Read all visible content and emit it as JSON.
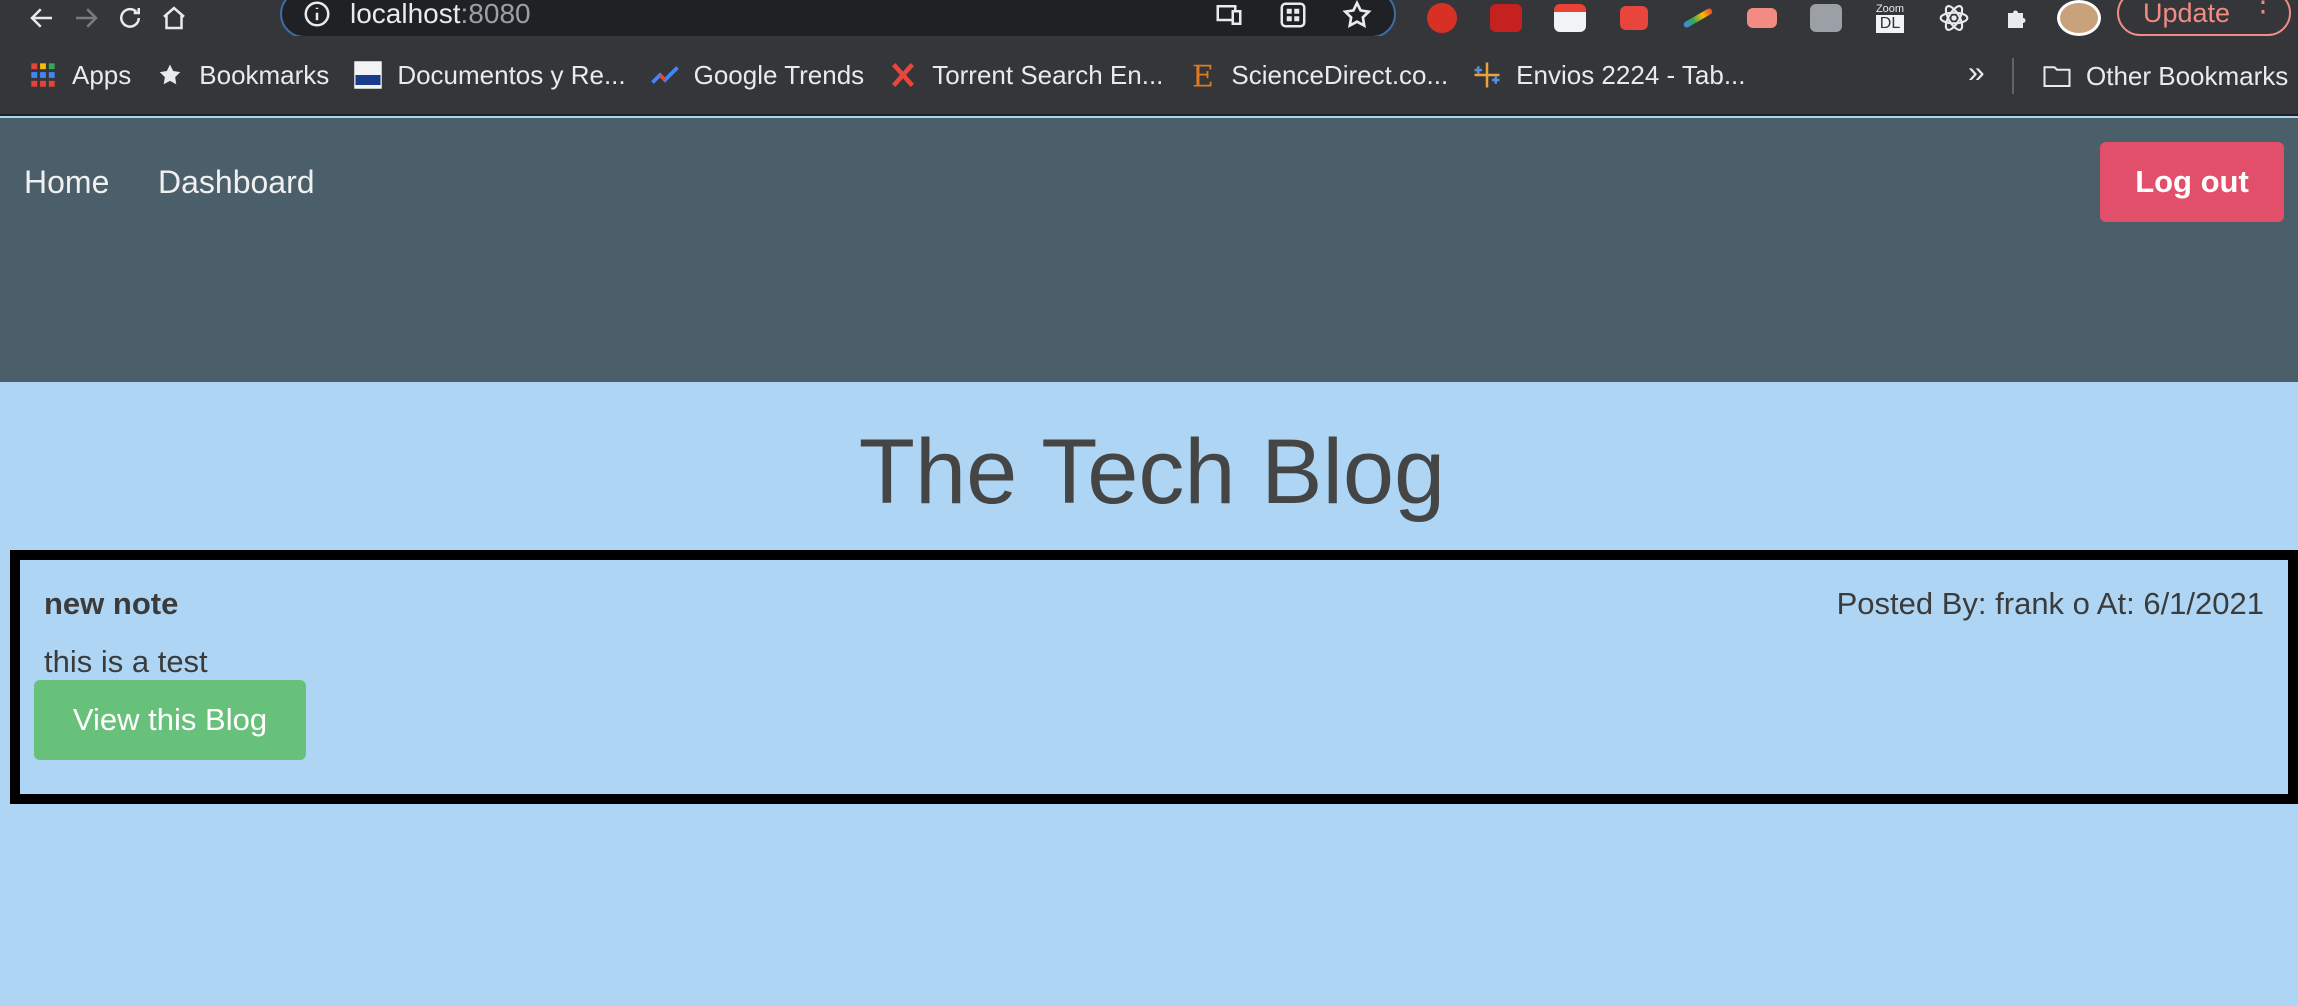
{
  "browser": {
    "url_host": "localhost",
    "url_port": ":8080",
    "update_label": "Update",
    "extensions": [
      "hand-stop-extension-icon",
      "fast-forward-extension-icon",
      "pdf-extension-icon",
      "ad-extension-icon",
      "color-picker-extension-icon",
      "video-extension-icon",
      "sleep-extension-icon",
      "zoom-dl-extension-icon",
      "react-devtools-extension-icon",
      "puzzle-extensions-icon"
    ],
    "zoom_top": "Zoom",
    "zoom_bottom": "DL"
  },
  "bookmarks": {
    "items": [
      {
        "label": "Apps",
        "icon": "apps-grid-icon"
      },
      {
        "label": "Bookmarks",
        "icon": "star-icon"
      },
      {
        "label": "Documentos y Re...",
        "icon": "uaf-logo-icon"
      },
      {
        "label": "Google Trends",
        "icon": "trends-icon"
      },
      {
        "label": "Torrent Search En...",
        "icon": "x-logo-icon"
      },
      {
        "label": "ScienceDirect.co...",
        "icon": "elsevier-icon"
      },
      {
        "label": "Envios 2224 - Tab...",
        "icon": "tableau-icon"
      }
    ],
    "more": "»",
    "other": "Other Bookmarks"
  },
  "navbar": {
    "home": "Home",
    "dashboard": "Dashboard",
    "logout": "Log out"
  },
  "main": {
    "title": "The Tech Blog",
    "post": {
      "title": "new note",
      "meta": "Posted By: frank o At: 6/1/2021",
      "body": "this is a test",
      "button": "View this Blog"
    }
  },
  "colors": {
    "navbar_bg": "#4a5f69",
    "page_bg": "#aed6f4",
    "logout_bg": "#e14f6a",
    "view_btn_bg": "#67c17a"
  }
}
